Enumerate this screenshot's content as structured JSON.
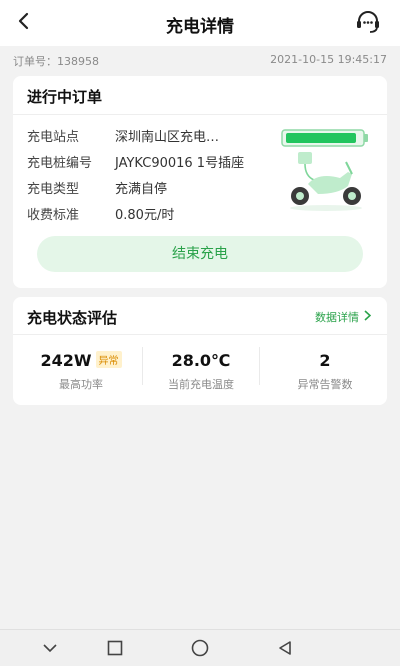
{
  "header": {
    "title": "充电详情",
    "back_icon": "chevron-left-icon",
    "support_icon": "headset-support-icon"
  },
  "order": {
    "number_label": "订单号：",
    "number": "138958",
    "datetime": "2021-10-15 19:45:17"
  },
  "active_order": {
    "title": "进行中订单",
    "rows": [
      {
        "key": "充电站点",
        "value": "深圳南山区充电…"
      },
      {
        "key": "充电桩编号",
        "value": "JAYKC90016 1号插座"
      },
      {
        "key": "充电类型",
        "value": "充满自停"
      },
      {
        "key": "收费标准",
        "value": "0.80元/时"
      }
    ],
    "end_button": "结束充电",
    "illustration_icon": "scooter-charging-icon"
  },
  "status": {
    "title": "充电状态评估",
    "detail_link": "数据详情",
    "stats": [
      {
        "value": "242W",
        "badge": "异常",
        "label": "最高功率"
      },
      {
        "value": "28.0℃",
        "label": "当前充电温度"
      },
      {
        "value": "2",
        "label": "异常告警数"
      }
    ]
  },
  "colors": {
    "accent": "#2aa24a",
    "badge": "#d98a00"
  },
  "navbar": {
    "icons": [
      "nav-down-icon",
      "nav-square-icon",
      "nav-circle-icon",
      "nav-back-triangle-icon"
    ]
  }
}
